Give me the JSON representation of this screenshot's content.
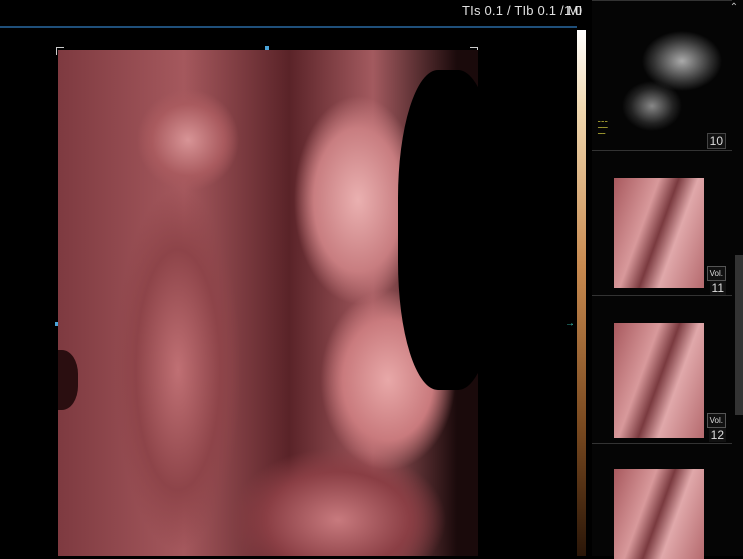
{
  "header": {
    "tis": "TIs 0.1",
    "tib": "TIb 0.1",
    "mi": "MI",
    "mi_value": "1.0"
  },
  "thumbnails": [
    {
      "index": "10",
      "mode": "2D",
      "vol_label": ""
    },
    {
      "index": "11",
      "mode": "3D",
      "vol_label": "Vol."
    },
    {
      "index": "12",
      "mode": "3D",
      "vol_label": "Vol."
    },
    {
      "index": "",
      "mode": "3D",
      "vol_label": ""
    }
  ],
  "colors": {
    "accent": "#1f4f7a",
    "marker": "#4aa3d8",
    "render": "#c87a7e"
  }
}
